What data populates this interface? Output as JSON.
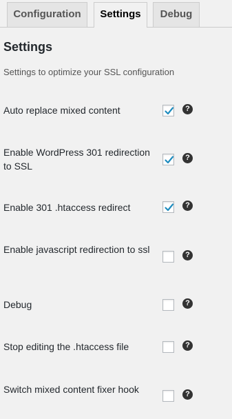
{
  "tabs": [
    {
      "label": "Configuration",
      "active": false
    },
    {
      "label": "Settings",
      "active": true
    },
    {
      "label": "Debug",
      "active": false
    }
  ],
  "settings": {
    "title": "Settings",
    "subtitle": "Settings to optimize your SSL configuration",
    "help_glyph": "?",
    "options": [
      {
        "label": "Auto replace mixed content",
        "checked": true
      },
      {
        "label": "Enable WordPress 301 redirection to SSL",
        "checked": true
      },
      {
        "label": "Enable 301 .htaccess redirect",
        "checked": true
      },
      {
        "label": "Enable javascript redirection to ssl",
        "checked": false
      },
      {
        "label": "Debug",
        "checked": false
      },
      {
        "label": "Stop editing the .htaccess file",
        "checked": false
      },
      {
        "label": "Switch mixed content fixer hook",
        "checked": false
      }
    ]
  },
  "colors": {
    "checkmark": "#1e8cbe",
    "background": "#f1f1f1",
    "help_icon": "#333333"
  }
}
